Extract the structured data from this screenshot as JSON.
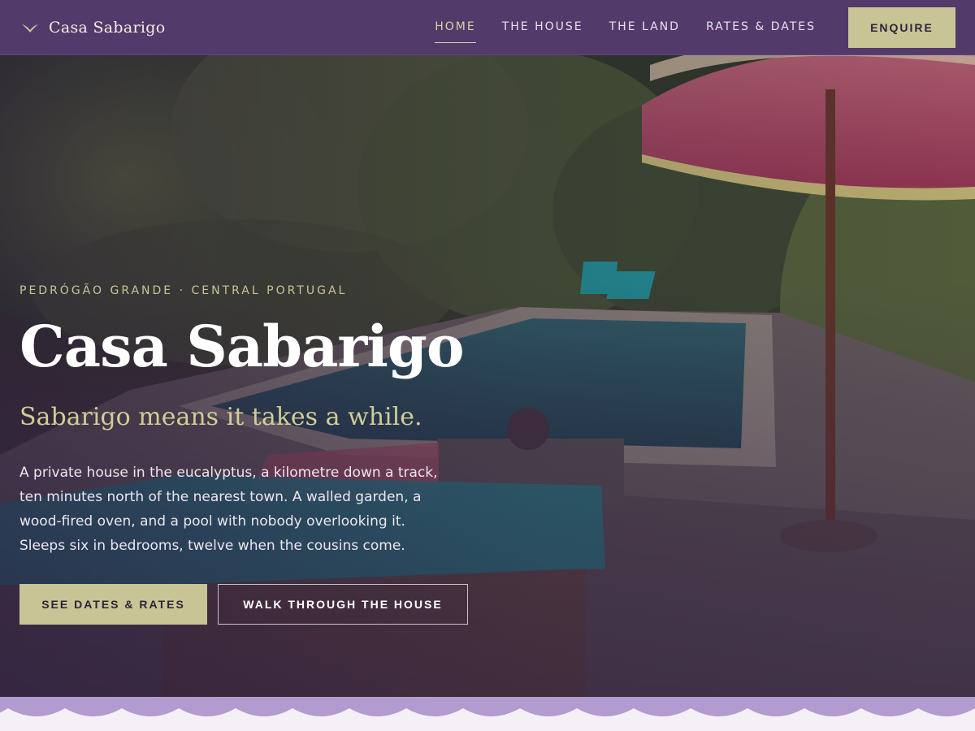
{
  "nav": {
    "brand": "Casa Sabarigo",
    "logo_icon": "swallow-icon",
    "items": [
      {
        "label": "HOME",
        "active": true
      },
      {
        "label": "THE HOUSE",
        "active": false
      },
      {
        "label": "THE LAND",
        "active": false
      },
      {
        "label": "RATES & DATES",
        "active": false
      }
    ],
    "cta": "ENQUIRE"
  },
  "hero": {
    "eyebrow": "PEDRÓGÃO GRANDE · CENTRAL PORTUGAL",
    "title": "Casa Sabarigo",
    "tagline": "Sabarigo means it takes a while.",
    "description": "A private house in the eucalyptus, a kilometre down a track, ten minutes north of the nearest town. A walled garden, a wood-fired oven, and a pool with nobody overlooking it. Sleeps six in bedrooms, twelve when the cousins come.",
    "primary_cta": "SEE DATES & RATES",
    "secondary_cta": "WALK THROUGH THE HOUSE"
  },
  "colors": {
    "nav_bg": "#523a6b",
    "accent": "#c9c496",
    "wave": "#b29bcf",
    "page_bg": "#f4f0f6"
  }
}
